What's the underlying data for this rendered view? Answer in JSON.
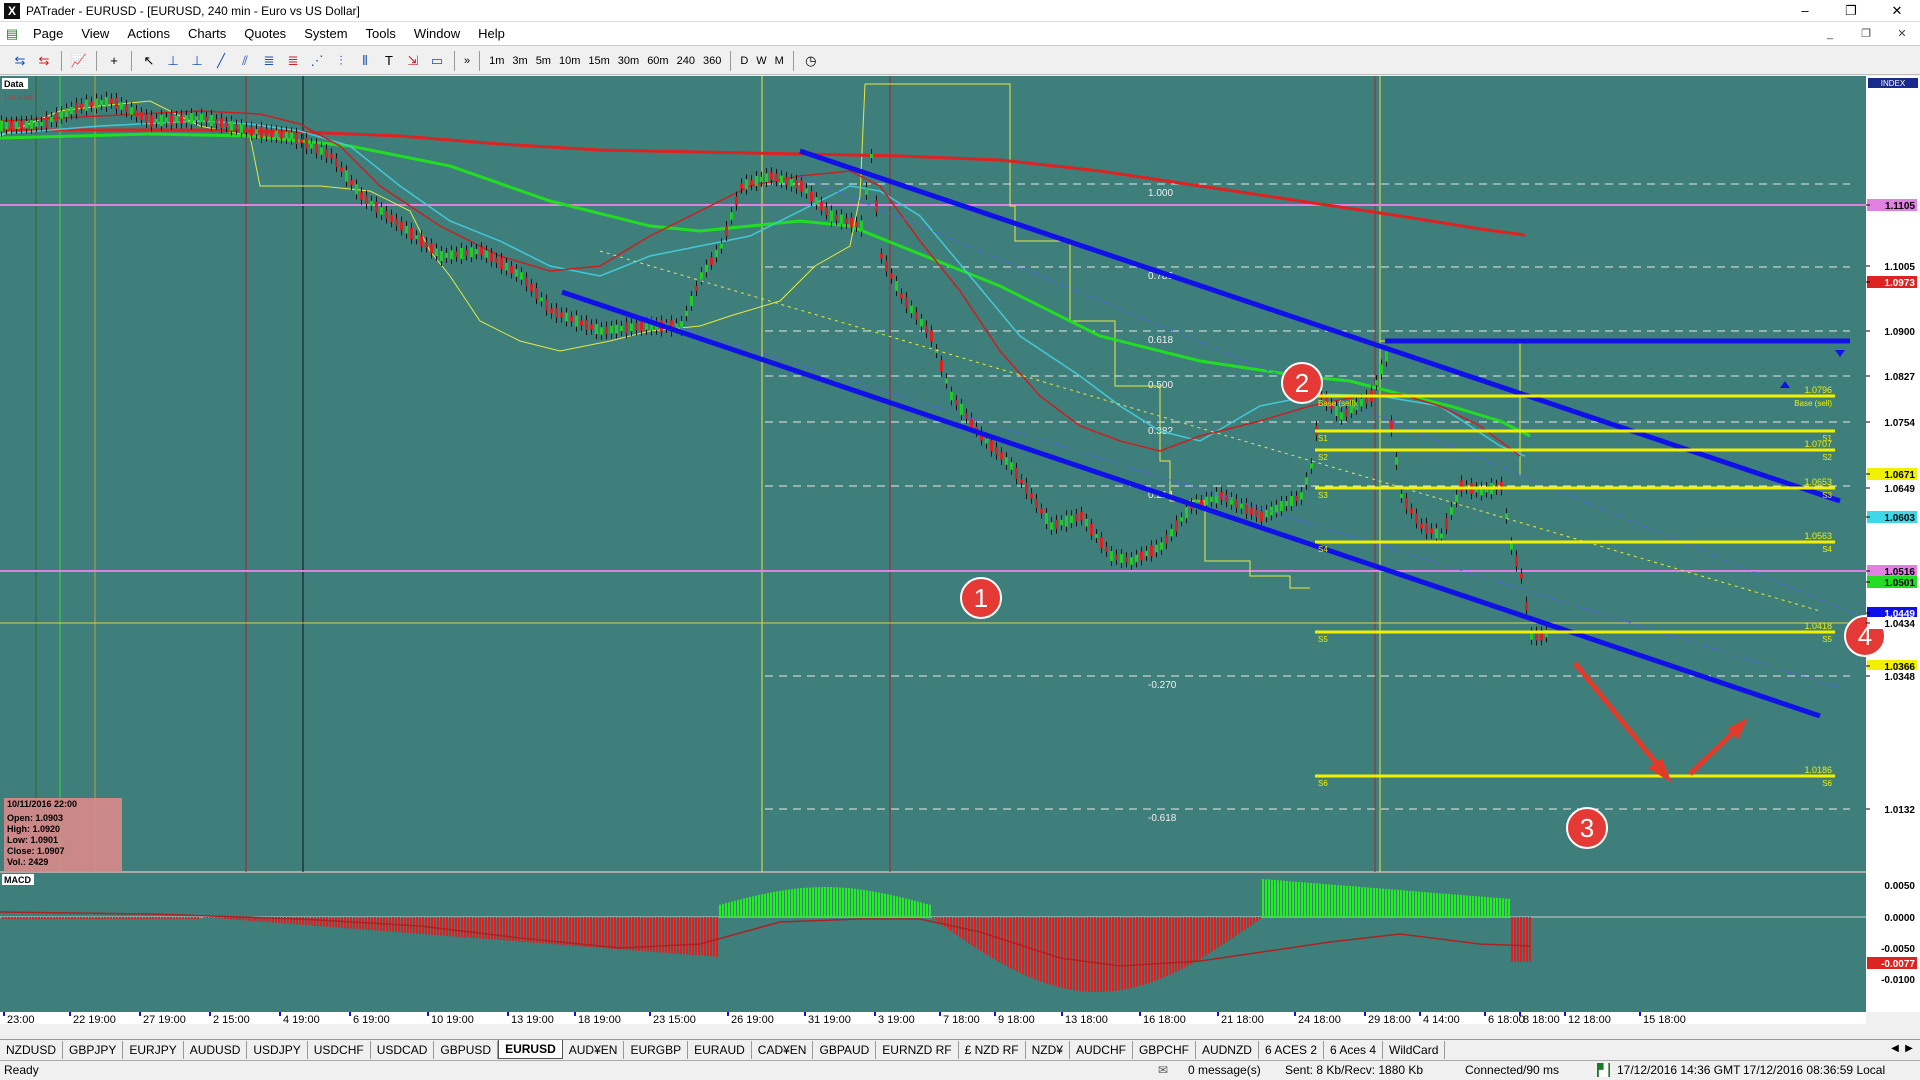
{
  "window": {
    "title": "PATrader - EURUSD - [EURUSD, 240 min - Euro vs US Dollar]",
    "controls": [
      "–",
      "❐",
      "✕"
    ]
  },
  "menu": {
    "items": [
      "Page",
      "View",
      "Actions",
      "Charts",
      "Quotes",
      "System",
      "Tools",
      "Window",
      "Help"
    ],
    "mdi_controls": [
      "_",
      "❐",
      "✕"
    ]
  },
  "toolbar": {
    "timeframes": [
      "1m",
      "3m",
      "5m",
      "10m",
      "15m",
      "30m",
      "60m",
      "240",
      "360",
      "D",
      "W",
      "M"
    ],
    "more_label": "»"
  },
  "chart": {
    "data_label": "Data",
    "locked_label": "Locked",
    "index_label": "INDEX",
    "macd_label": "MACD",
    "info_box": {
      "datetime": "10/11/2016 22:00",
      "open": "Open: 1.0903",
      "high": "High: 1.0920",
      "low": "Low: 1.0901",
      "close": "Close: 1.0907",
      "vol": "Vol.: 2429"
    },
    "fib_labels": [
      "1.000",
      "0.786",
      "0.618",
      "0.500",
      "0.382",
      "0.214",
      "-0.270",
      "-0.618"
    ],
    "pivot_labels": {
      "base": "Base (sell)",
      "base_price": "1.0796",
      "s1_price": "1.0707",
      "s2_price": "1.0653",
      "s4_price": "1.0563",
      "s5_price": "1.0418",
      "s6_price": "1.0186",
      "s1": "S1",
      "s2": "S2",
      "s3": "S3",
      "s4": "S4",
      "s5": "S5",
      "s6": "S6"
    },
    "price_axis": [
      "1.1105",
      "1.1005",
      "1.0973",
      "1.0900",
      "1.0827",
      "1.0754",
      "1.0671",
      "1.0649",
      "1.0603",
      "1.0516",
      "1.0501",
      "1.0449",
      "1.0434",
      "1.0366",
      "1.0348",
      "1.0132"
    ],
    "macd_axis": [
      "0.0050",
      "0.0000",
      "-0.0050",
      "-0.0077",
      "-0.0100"
    ],
    "time_axis": [
      "23:00",
      "22 19:00",
      "27 19:00",
      "2 15:00",
      "4 19:00",
      "6 19:00",
      "10 19:00",
      "13 19:00",
      "18 19:00",
      "23 15:00",
      "26 19:00",
      "31 19:00",
      "3 19:00",
      "7 18:00",
      "9 18:00",
      "13 18:00",
      "16 18:00",
      "21 18:00",
      "24 18:00",
      "29 18:00",
      "4 14:00",
      "6 18:00",
      "8 18:00",
      "12 18:00",
      "15 18:00"
    ],
    "markers": [
      "1",
      "2",
      "3",
      "4"
    ],
    "colors": {
      "background": "#3f7f7b",
      "channel": "#1010e8",
      "ema_green": "#22dd22",
      "ema_red": "#dd2222",
      "pivot_yellow": "#f0f000",
      "magenta": "#e080e0",
      "marker_red": "#e53935"
    }
  },
  "tabs": [
    "NZDUSD",
    "GBPJPY",
    "EURJPY",
    "AUDUSD",
    "USDJPY",
    "USDCHF",
    "USDCAD",
    "GBPUSD",
    "EURUSD",
    "AUD¥EN",
    "EURGBP",
    "EURAUD",
    "CAD¥EN",
    "GBPAUD",
    "EURNZD RF",
    "£ NZD RF",
    "NZD¥",
    "AUDCHF",
    "GBPCHF",
    "AUDNZD",
    "6 ACES 2",
    "6 Aces 4",
    "WildCard"
  ],
  "active_tab": "EURUSD",
  "status": {
    "ready": "Ready",
    "messages": "0 message(s)",
    "traffic": "Sent: 8 Kb/Recv: 1880 Kb",
    "connection": "Connected/90 ms",
    "gmt_time": "17/12/2016 14:36 GMT",
    "local_time": "17/12/2016 08:36:59 Local"
  }
}
